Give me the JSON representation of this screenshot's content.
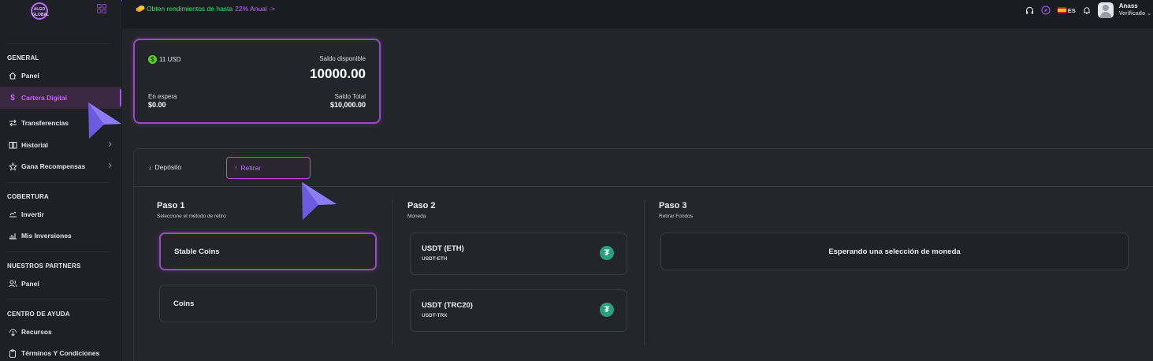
{
  "brand": {
    "logo_text": "ALGO GLOBAL"
  },
  "promo": {
    "text": "Obten rendimientos de hasta",
    "highlight": "22% Anual ->"
  },
  "topbar": {
    "language": "ES",
    "user_name": "Anass",
    "user_status": "Verificado"
  },
  "sidebar": {
    "sections": [
      {
        "title": "GENERAL",
        "items": [
          {
            "label": "Panel",
            "icon": "home-icon"
          },
          {
            "label": "Cartera Digital",
            "icon": "dollar-icon",
            "active": true
          },
          {
            "label": "Transferencias",
            "icon": "transfer-icon"
          },
          {
            "label": "Historial",
            "icon": "book-icon",
            "has_chevron": true
          },
          {
            "label": "Gana Recompensas",
            "icon": "star-icon",
            "has_chevron": true
          }
        ]
      },
      {
        "title": "COBERTURA",
        "items": [
          {
            "label": "Invertir",
            "icon": "invest-icon"
          },
          {
            "label": "Mis Inversiones",
            "icon": "chart-icon"
          }
        ]
      },
      {
        "title": "NUESTROS PARTNERS",
        "items": [
          {
            "label": "Panel",
            "icon": "users-icon"
          }
        ]
      },
      {
        "title": "CENTRO DE AYUDA",
        "items": [
          {
            "label": "Recursos",
            "icon": "resources-icon"
          },
          {
            "label": "Términos Y Condiciones",
            "icon": "clipboard-icon"
          }
        ]
      }
    ]
  },
  "balance": {
    "currency_badge": "11 USD",
    "available_label": "Saldo disponible",
    "available_value": "10000.00",
    "pending_label": "En espera",
    "pending_value": "$0.00",
    "total_label": "Saldo Total",
    "total_value": "$10,000.00"
  },
  "tabs": {
    "deposit": "Depósito",
    "withdraw": "Retirar"
  },
  "steps": [
    {
      "title": "Paso 1",
      "subtitle": "Seleccione el método de retiro"
    },
    {
      "title": "Paso 2",
      "subtitle": "Moneda"
    },
    {
      "title": "Paso 3",
      "subtitle": "Retirar Fondos"
    }
  ],
  "methods": [
    {
      "label": "Stable Coins",
      "selected": true
    },
    {
      "label": "Coins",
      "selected": false
    }
  ],
  "coins": [
    {
      "name": "USDT (ETH)",
      "code": "USDT-ETH",
      "icon": "tether-icon"
    },
    {
      "name": "USDT (TRC20)",
      "code": "USDT-TRX",
      "icon": "tether-icon"
    }
  ],
  "step3": {
    "waiting": "Esperando una selección de moneda"
  },
  "colors": {
    "accent": "#b44fe3",
    "promo_green": "#3ee06a",
    "tether": "#26a17b",
    "badge_green": "#5ecb2a"
  }
}
